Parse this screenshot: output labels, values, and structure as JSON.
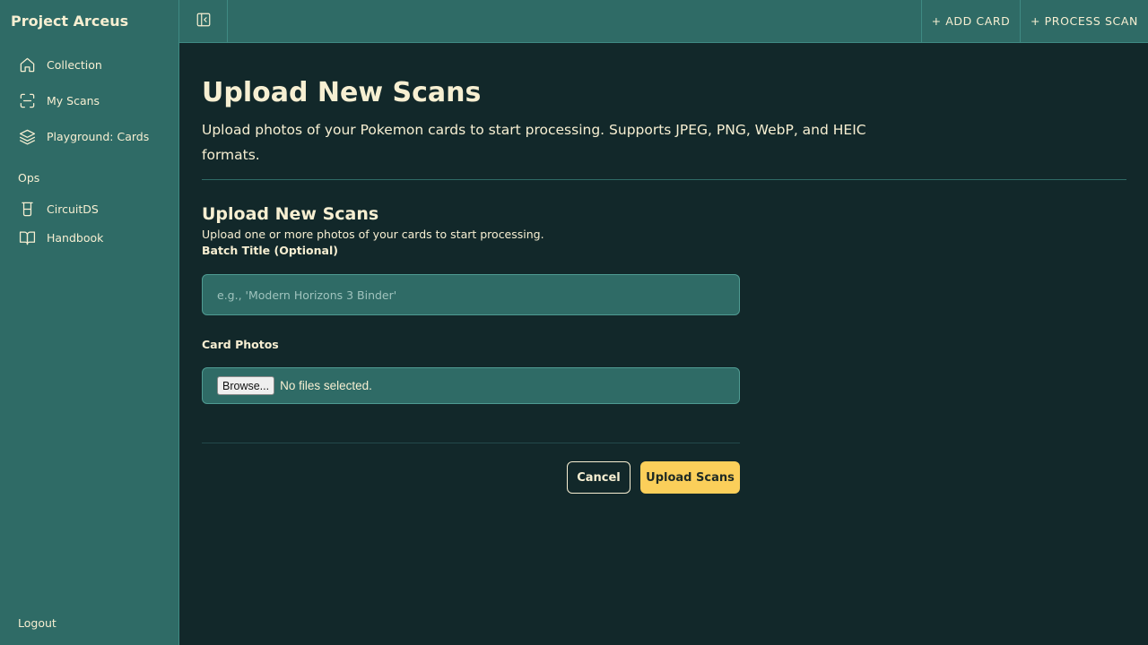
{
  "app": {
    "title": "Project Arceus"
  },
  "sidebar": {
    "items": [
      {
        "label": "Collection",
        "icon": "home-icon"
      },
      {
        "label": "My Scans",
        "icon": "scan-icon"
      },
      {
        "label": "Playground: Cards",
        "icon": "layers-icon"
      }
    ],
    "ops_label": "Ops",
    "ops_items": [
      {
        "label": "CircuitDS",
        "icon": "beaker-icon"
      },
      {
        "label": "Handbook",
        "icon": "book-open-icon"
      }
    ],
    "logout_label": "Logout"
  },
  "topbar": {
    "toggle_icon": "sidebar-collapse-icon",
    "add_card_label": "+ ADD CARD",
    "process_scan_label": "+ PROCESS SCAN"
  },
  "page": {
    "title": "Upload New Scans",
    "description": "Upload photos of your Pokemon cards to start processing. Supports JPEG, PNG, WebP, and HEIC formats."
  },
  "form": {
    "title": "Upload New Scans",
    "description": "Upload one or more photos of your cards to start processing.",
    "batch_title_label": "Batch Title (Optional)",
    "batch_title_placeholder": "e.g., 'Modern Horizons 3 Binder'",
    "batch_title_value": "",
    "card_photos_label": "Card Photos",
    "browse_label": "Browse...",
    "file_status": "No files selected.",
    "cancel_label": "Cancel",
    "submit_label": "Upload Scans"
  },
  "colors": {
    "sidebar_bg": "#2f6b66",
    "main_bg": "#12282a",
    "text": "#f7efd2",
    "accent": "#fbcf5a"
  }
}
